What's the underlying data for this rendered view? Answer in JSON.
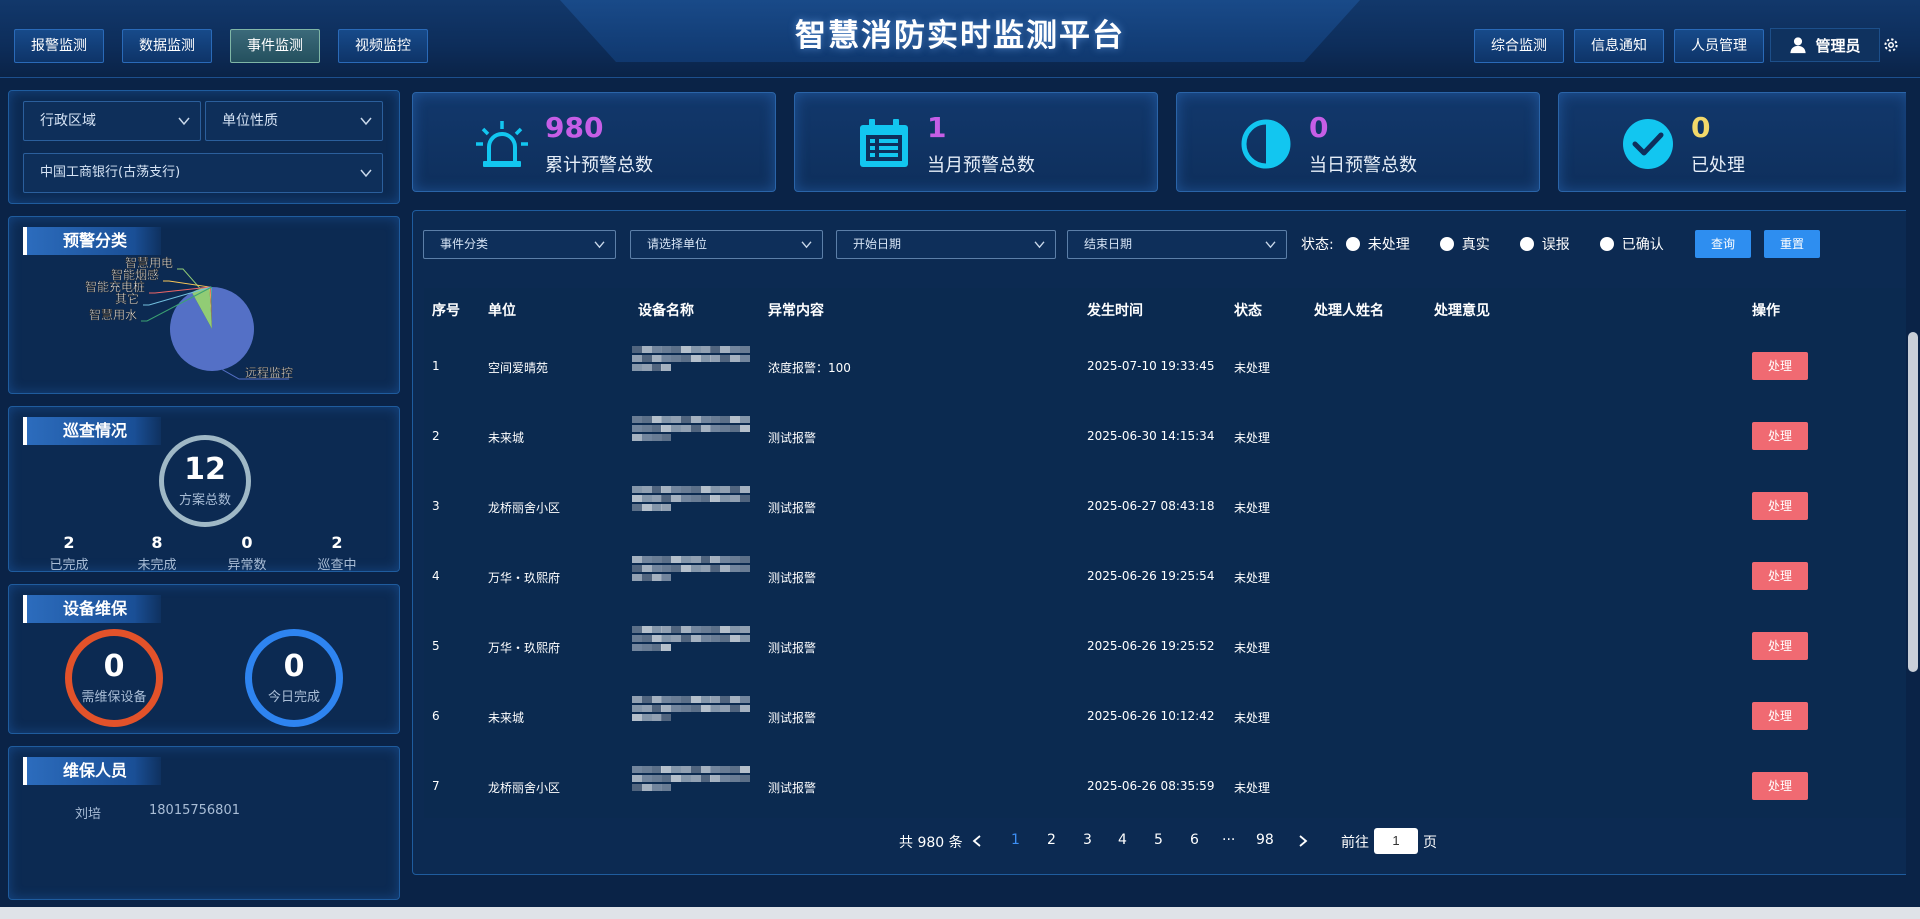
{
  "header": {
    "title": "智慧消防实时监测平台",
    "left_nav": [
      "报警监测",
      "数据监测",
      "事件监测",
      "视频监控"
    ],
    "active_nav": "事件监测",
    "right_nav": [
      "综合监测",
      "信息通知",
      "人员管理"
    ],
    "user": "管理员"
  },
  "filters_left": {
    "region": "行政区域",
    "unit_type": "单位性质",
    "unit": "中国工商银行(古荡支行)"
  },
  "warning_panel": {
    "title": "预警分类"
  },
  "chart_data": {
    "type": "pie",
    "categories": [
      "远程监控",
      "智慧用电",
      "智能烟感",
      "智能充电桩",
      "其它",
      "智慧用水"
    ],
    "values": [
      92,
      7,
      0.3,
      0.3,
      0.2,
      0.2
    ]
  },
  "patrol": {
    "title": "巡查情况",
    "total": "12",
    "total_label": "方案总数",
    "stats": [
      {
        "value": "2",
        "label": "已完成"
      },
      {
        "value": "8",
        "label": "未完成"
      },
      {
        "value": "0",
        "label": "异常数"
      },
      {
        "value": "2",
        "label": "巡查中"
      }
    ]
  },
  "maintenance": {
    "title": "设备维保",
    "need": "0",
    "need_label": "需维保设备",
    "done": "0",
    "done_label": "今日完成"
  },
  "staff": {
    "title": "维保人员",
    "name": "刘培",
    "phone": "18015756801"
  },
  "cards": [
    {
      "value": "980",
      "label": "累计预警总数",
      "color": "#c65ee6"
    },
    {
      "value": "1",
      "label": "当月预警总数",
      "color": "#c65ee6"
    },
    {
      "value": "0",
      "label": "当日预警总数",
      "color": "#c65ee6"
    },
    {
      "value": "0",
      "label": "已处理",
      "color": "#f3d96a"
    }
  ],
  "table_filters": {
    "category": "事件分类",
    "unit": "请选择单位",
    "start": "开始日期",
    "end": "结束日期",
    "status_label": "状态:",
    "statuses": [
      "未处理",
      "真实",
      "误报",
      "已确认"
    ],
    "query": "查询",
    "reset": "重置"
  },
  "table": {
    "headers": [
      "序号",
      "单位",
      "设备名称",
      "异常内容",
      "发生时间",
      "状态",
      "处理人姓名",
      "处理意见",
      "操作"
    ],
    "action_label": "处理",
    "rows": [
      {
        "no": "1",
        "unit": "空间爱晴苑",
        "content": "浓度报警：100",
        "time": "2025-07-10 19:33:45",
        "status": "未处理"
      },
      {
        "no": "2",
        "unit": "未来城",
        "content": "测试报警",
        "time": "2025-06-30 14:15:34",
        "status": "未处理"
      },
      {
        "no": "3",
        "unit": "龙桥丽舍小区",
        "content": "测试报警",
        "time": "2025-06-27 08:43:18",
        "status": "未处理"
      },
      {
        "no": "4",
        "unit": "万华・玖熙府",
        "content": "测试报警",
        "time": "2025-06-26 19:25:54",
        "status": "未处理"
      },
      {
        "no": "5",
        "unit": "万华・玖熙府",
        "content": "测试报警",
        "time": "2025-06-26 19:25:52",
        "status": "未处理"
      },
      {
        "no": "6",
        "unit": "未来城",
        "content": "测试报警",
        "time": "2025-06-26 10:12:42",
        "status": "未处理"
      },
      {
        "no": "7",
        "unit": "龙桥丽舍小区",
        "content": "测试报警",
        "time": "2025-06-26 08:35:59",
        "status": "未处理"
      }
    ]
  },
  "pagination": {
    "total": "共 980 条",
    "pages": [
      "1",
      "2",
      "3",
      "4",
      "5",
      "6",
      "···",
      "98"
    ],
    "current": "1",
    "goto_prefix": "前往",
    "goto_value": "1",
    "goto_suffix": "页"
  }
}
